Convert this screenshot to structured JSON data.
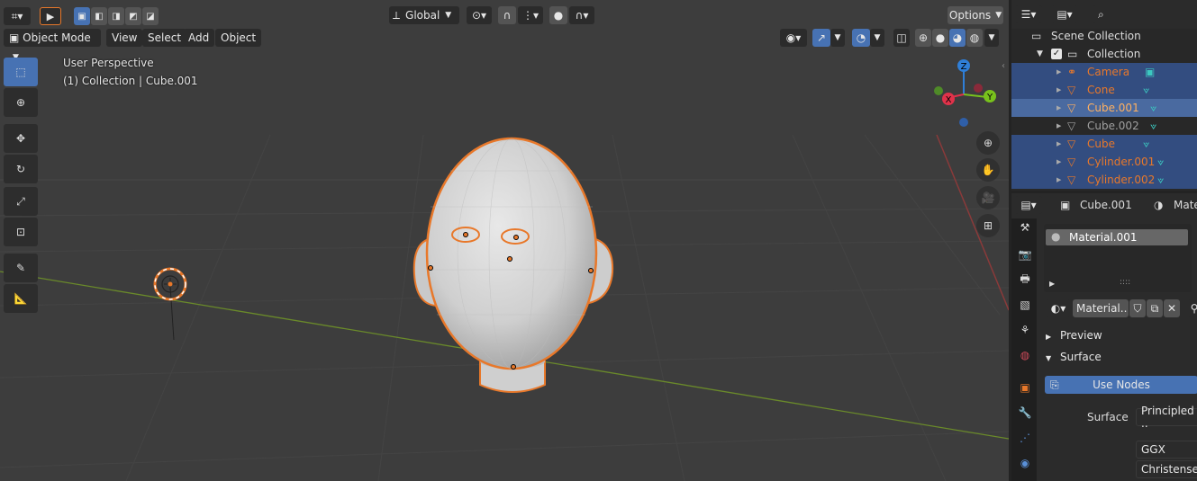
{
  "viewport_header": {
    "transform_orientation": "Global",
    "options_label": "Options"
  },
  "viewport_menu": {
    "mode": "Object Mode",
    "view": "View",
    "select": "Select",
    "add": "Add",
    "object": "Object"
  },
  "overlay": {
    "perspective": "User Perspective",
    "collection_object": "(1) Collection | Cube.001"
  },
  "gizmo": {
    "z": "Z",
    "x": "X",
    "y": "Y"
  },
  "outliner": {
    "scene_collection": "Scene Collection",
    "collection": "Collection",
    "items": [
      {
        "name": "Camera",
        "state": "selected",
        "icon": "camera-icon"
      },
      {
        "name": "Cone",
        "state": "selected",
        "icon": "mesh-icon"
      },
      {
        "name": "Cube.001",
        "state": "active",
        "icon": "mesh-icon"
      },
      {
        "name": "Cube.002",
        "state": "normal",
        "icon": "mesh-icon"
      },
      {
        "name": "Cube",
        "state": "selected",
        "icon": "mesh-icon"
      },
      {
        "name": "Cylinder.001",
        "state": "selected",
        "icon": "mesh-icon"
      },
      {
        "name": "Cylinder.002",
        "state": "selected",
        "icon": "mesh-icon"
      }
    ]
  },
  "properties": {
    "object_name": "Cube.001",
    "material_tab": "Mate",
    "slot_name": "Material.001",
    "slot_dots": "::::",
    "material_field": "Material..",
    "preview_label": "Preview",
    "surface_label": "Surface",
    "use_nodes_label": "Use Nodes",
    "surface_field_label": "Surface",
    "surface_value": "Principled ..",
    "distribution": "GGX",
    "subsurface_method": "Christensen-.."
  },
  "colors": {
    "selected_orange": "#e8782a",
    "active_blue": "#4772b3",
    "axis_x": "#e0324a",
    "axis_y": "#78c21c",
    "axis_z": "#2f7fd8"
  }
}
